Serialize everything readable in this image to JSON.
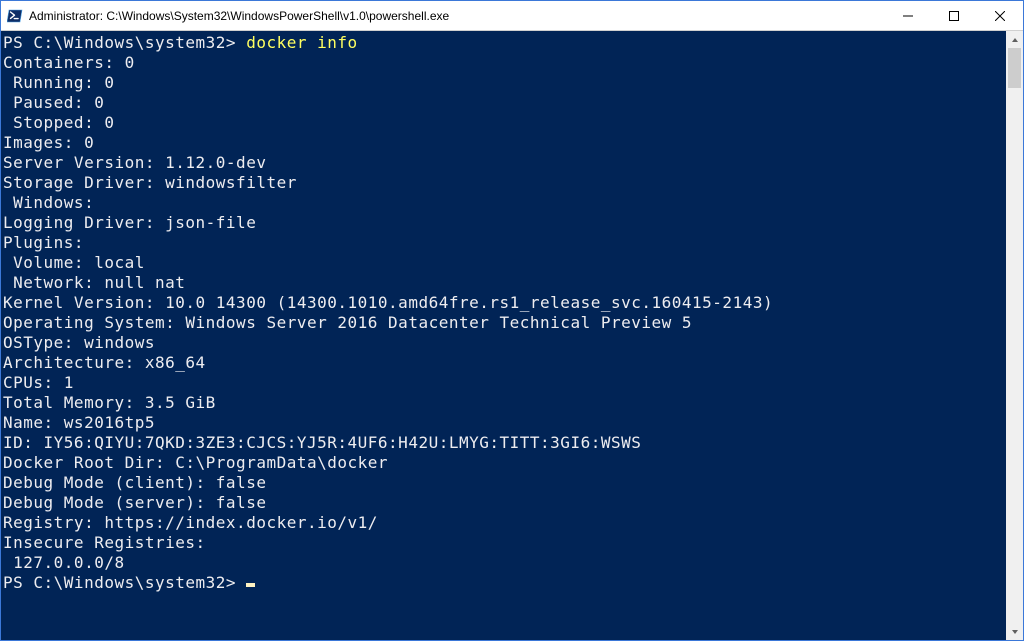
{
  "window": {
    "title": "Administrator: C:\\Windows\\System32\\WindowsPowerShell\\v1.0\\powershell.exe"
  },
  "prompt1": {
    "ps": "PS C:\\Windows\\system32> ",
    "cmd": "docker info"
  },
  "output": "Containers: 0\n Running: 0\n Paused: 0\n Stopped: 0\nImages: 0\nServer Version: 1.12.0-dev\nStorage Driver: windowsfilter\n Windows:\nLogging Driver: json-file\nPlugins:\n Volume: local\n Network: null nat\nKernel Version: 10.0 14300 (14300.1010.amd64fre.rs1_release_svc.160415-2143)\nOperating System: Windows Server 2016 Datacenter Technical Preview 5\nOSType: windows\nArchitecture: x86_64\nCPUs: 1\nTotal Memory: 3.5 GiB\nName: ws2016tp5\nID: IY56:QIYU:7QKD:3ZE3:CJCS:YJ5R:4UF6:H42U:LMYG:TITT:3GI6:WSWS\nDocker Root Dir: C:\\ProgramData\\docker\nDebug Mode (client): false\nDebug Mode (server): false\nRegistry: https://index.docker.io/v1/\nInsecure Registries:\n 127.0.0.0/8",
  "prompt2": {
    "ps": "PS C:\\Windows\\system32> "
  }
}
